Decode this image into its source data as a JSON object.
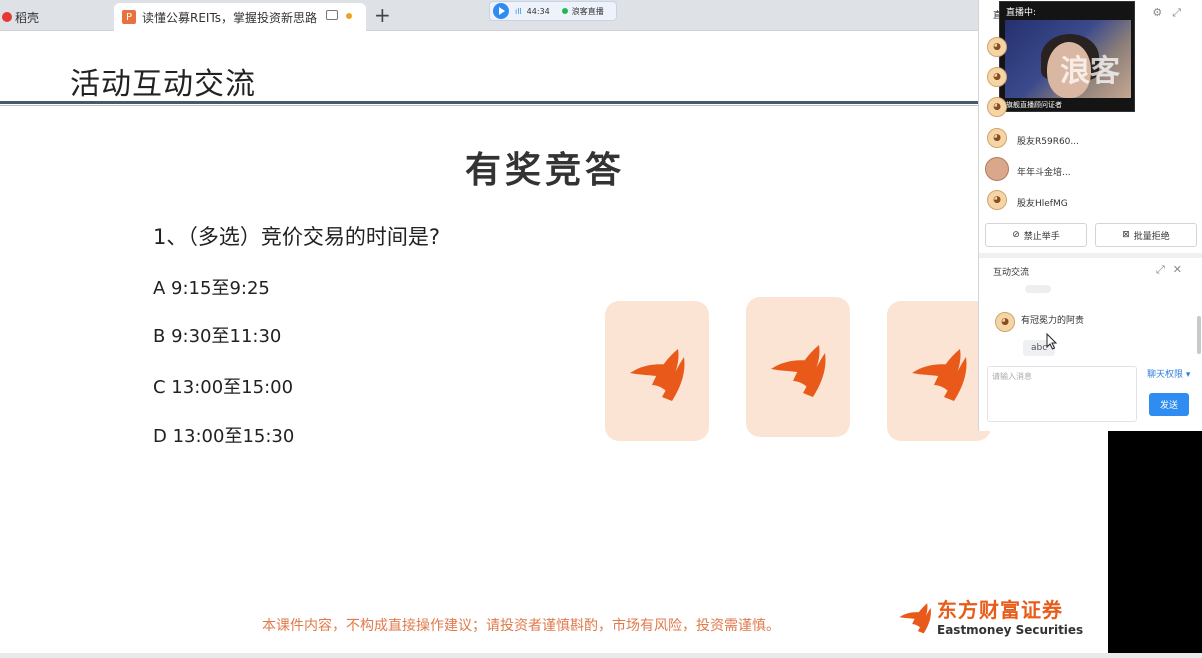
{
  "browser": {
    "tabs": [
      {
        "label": "稻壳"
      },
      {
        "label": "读懂公募REITs，掌握投资新思路",
        "icon_char": "P"
      }
    ],
    "new_tab": "+"
  },
  "live_status": {
    "signal": "ıll",
    "time": "44:34",
    "status": "浪客直播"
  },
  "slide": {
    "title": "活动互动交流",
    "heading": "有奖竞答",
    "question": "1、（多选）竞价交易的时间是?",
    "options": [
      {
        "text": "A  9:15至9:25"
      },
      {
        "text": "B  9:30至11:30"
      },
      {
        "text": "C  13:00至15:00"
      },
      {
        "text": "D  13:00至15:30"
      }
    ],
    "disclaimer": "本课件内容，不构成直接操作建议；请投资者谨慎斟酌，市场有风险，投资需谨慎。",
    "logo_cn": "东方财富证券",
    "logo_en": "Eastmoney Securities",
    "brand_color": "#e85c1a"
  },
  "panel": {
    "header_prefix": "直",
    "video": {
      "live_label": "直播中:",
      "watermark": "浪客",
      "caption": "旗舰直播顾问证者"
    },
    "viewers": [
      {
        "name": "股友R59R60..."
      },
      {
        "name": "年年斗金培..."
      },
      {
        "name": "股友HlefMG"
      }
    ],
    "buttons": {
      "ban": "禁止举手",
      "batch_reject": "批量拒绝"
    },
    "chat": {
      "title": "互动交流",
      "message_user": "有冠冕力的阿贵",
      "message_text": "abc",
      "input_placeholder": "请输入消息",
      "permission": "聊天权限 ▾",
      "send": "发送"
    },
    "accent": "#2f8cf0"
  }
}
